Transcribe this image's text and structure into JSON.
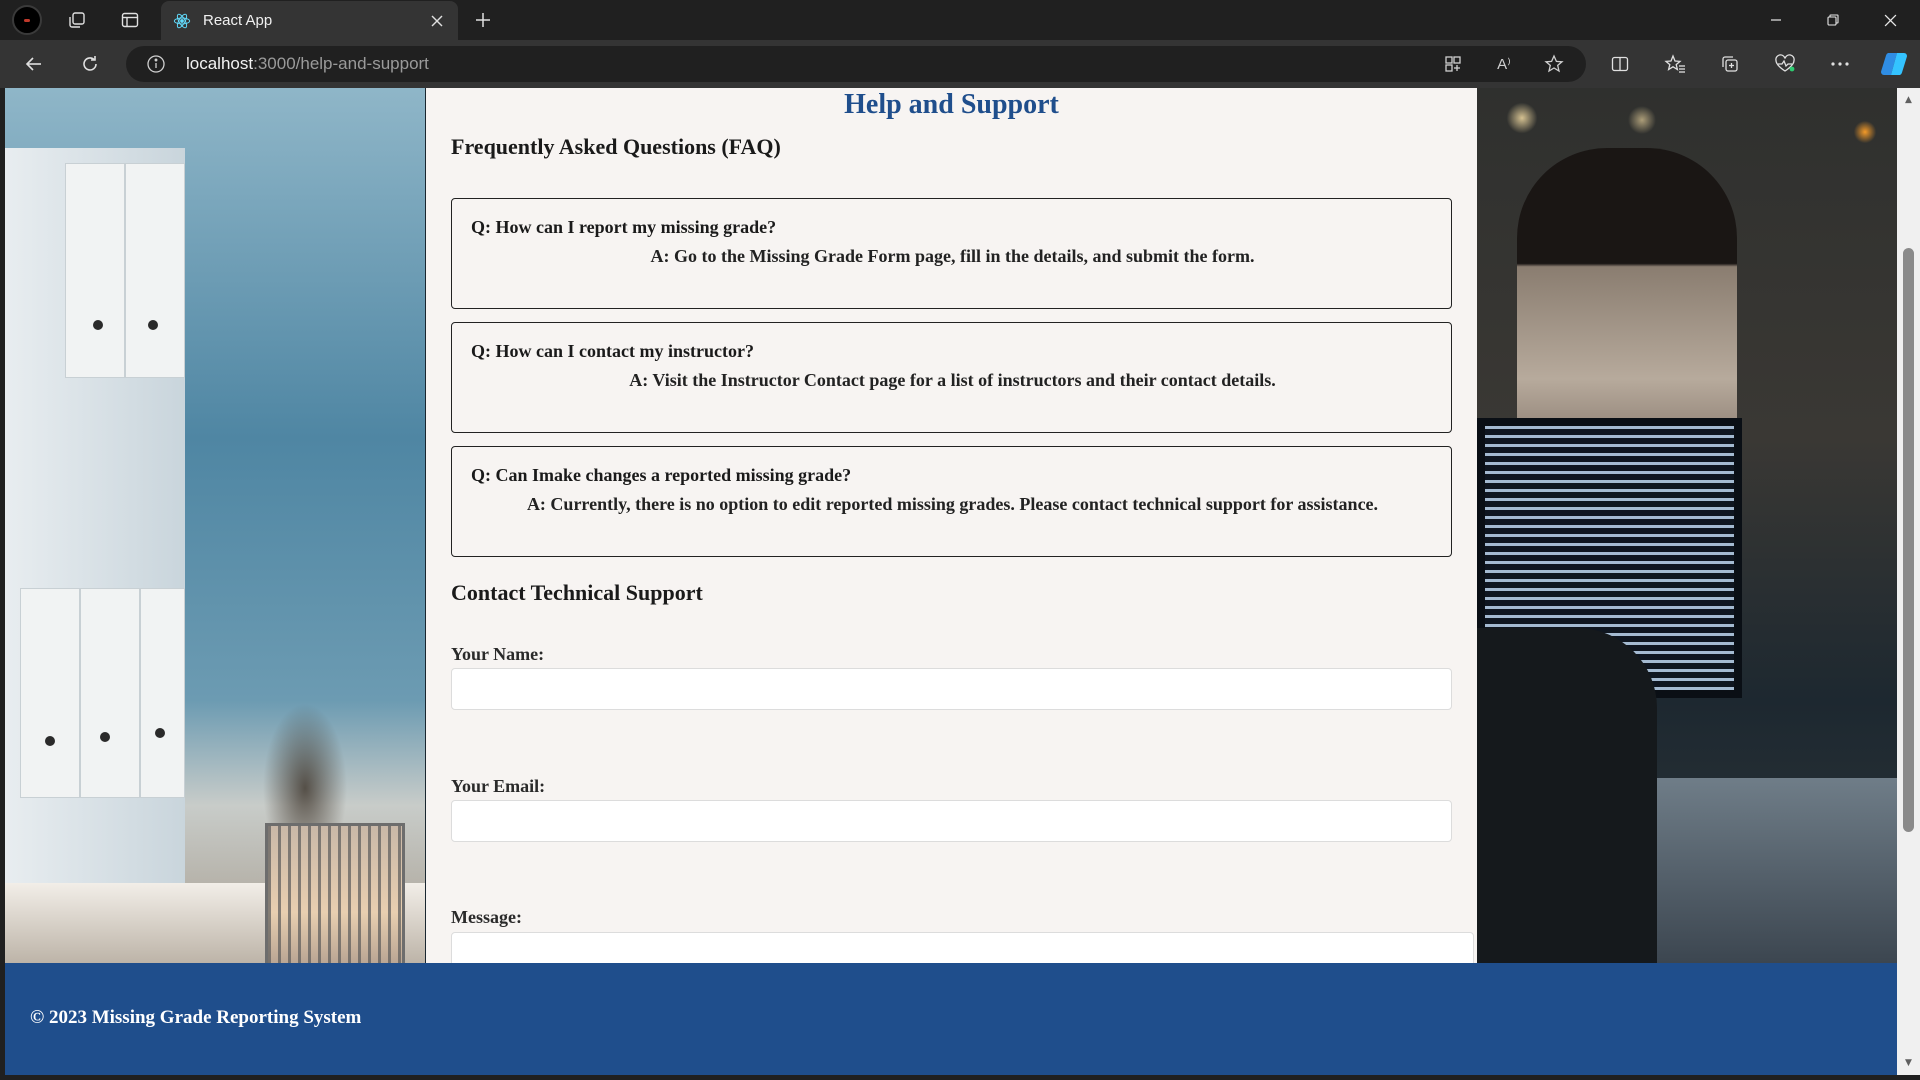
{
  "browser": {
    "tab_title": "React App",
    "url_host": "localhost",
    "url_path": ":3000/help-and-support",
    "read_aloud_label": "A⁾"
  },
  "page": {
    "title": "Help and Support",
    "faq_heading": "Frequently Asked Questions (FAQ)",
    "faqs": [
      {
        "q": "Q: How can I report my missing grade?",
        "a": "A: Go to the Missing Grade Form page, fill in the details, and submit the form."
      },
      {
        "q": "Q: How can I contact my instructor?",
        "a": "A: Visit the Instructor Contact page for a list of instructors and their contact details."
      },
      {
        "q": "Q: Can Imake changes a reported missing grade?",
        "a": "A: Currently, there is no option to edit reported missing grades. Please contact technical support for assistance."
      }
    ],
    "contact_heading": "Contact Technical Support",
    "form": {
      "name_label": "Your Name:",
      "name_value": "",
      "email_label": "Your Email:",
      "email_value": "",
      "message_label": "Message:",
      "message_value": ""
    },
    "footer_text": "© 2023 Missing Grade Reporting System"
  },
  "colors": {
    "brand_blue": "#1f4e8c",
    "content_bg": "#f7f4f2",
    "chrome_dark": "#202020",
    "chrome_toolbar": "#343434"
  },
  "icons": {
    "profile": "profile-avatar-icon",
    "workspaces": "workspaces-icon",
    "vertical_tabs": "tab-actions-icon",
    "tab_favicon": "react-logo-icon",
    "tab_close": "close-icon",
    "new_tab": "plus-icon",
    "minimize": "minimize-icon",
    "restore": "restore-icon",
    "close_window": "close-icon",
    "back": "arrow-left-icon",
    "refresh": "refresh-icon",
    "site_info": "info-icon",
    "app_available": "apps-icon",
    "read_aloud": "read-aloud-icon",
    "favorite": "star-icon",
    "split_screen": "split-screen-icon",
    "favorites": "favorites-icon",
    "collections": "collections-icon",
    "performance": "heart-pulse-icon",
    "more": "ellipsis-icon",
    "copilot": "copilot-icon"
  }
}
